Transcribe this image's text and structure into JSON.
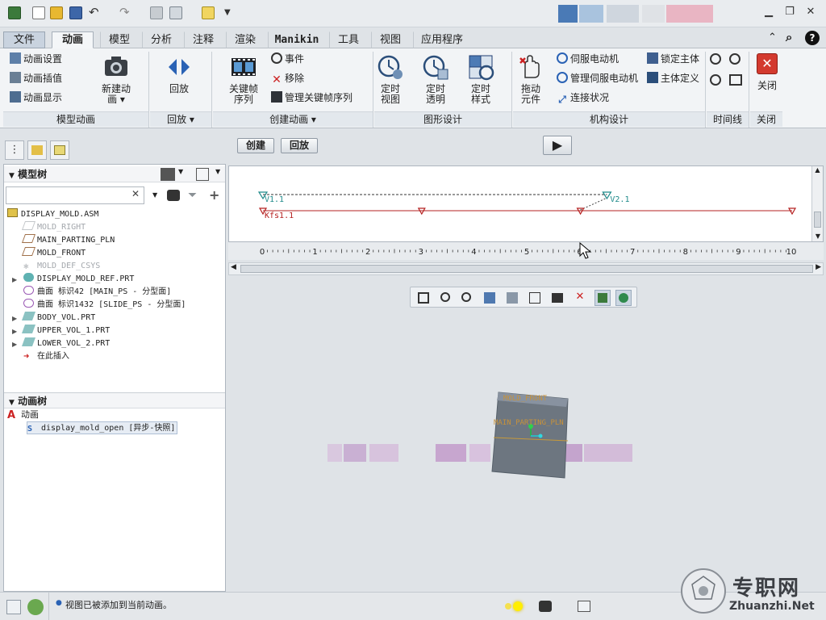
{
  "ribbon_tabs": [
    "文件",
    "动画",
    "模型",
    "分析",
    "注释",
    "渲染",
    "Manikin",
    "工具",
    "视图",
    "应用程序"
  ],
  "ribbon": {
    "model_anim": {
      "settings": "动画设置",
      "interp": "动画插值",
      "display": "动画显示",
      "new_line1": "新建动",
      "new_line2": "画",
      "group": "模型动画"
    },
    "playback": {
      "label": "回放",
      "group": "回放"
    },
    "create": {
      "keyframe_line1": "关键帧",
      "keyframe_line2": "序列",
      "event": "事件",
      "remove": "移除",
      "manage": "管理关键帧序列",
      "group": "创建动画"
    },
    "graphics": {
      "timed_view_line1": "定时",
      "timed_view_line2": "视图",
      "timed_trans_line1": "定时",
      "timed_trans_line2": "透明",
      "timed_style_line1": "定时",
      "timed_style_line2": "样式",
      "group": "图形设计"
    },
    "mech": {
      "drag_line1": "拖动",
      "drag_line2": "元件",
      "servo": "伺服电动机",
      "manage_servo": "管理伺服电动机",
      "conn": "连接状况",
      "lock": "锁定主体",
      "body_def": "主体定义",
      "group": "机构设计"
    },
    "timeline": {
      "group": "时间线"
    },
    "close": {
      "label": "关闭",
      "group": "关闭"
    }
  },
  "action_buttons": {
    "create": "创建",
    "playback": "回放"
  },
  "model_tree": {
    "title": "模型树",
    "items": [
      {
        "label": "DISPLAY_MOLD.ASM",
        "dim": false
      },
      {
        "label": "MOLD_RIGHT",
        "dim": true
      },
      {
        "label": "MAIN_PARTING_PLN",
        "dim": false
      },
      {
        "label": "MOLD_FRONT",
        "dim": false
      },
      {
        "label": "MOLD_DEF_CSYS",
        "dim": true
      },
      {
        "label": "DISPLAY_MOLD_REF.PRT",
        "dim": false
      },
      {
        "label": "曲面 标识42 [MAIN_PS - 分型面]",
        "dim": false
      },
      {
        "label": "曲面 标识1432 [SLIDE_PS - 分型面]",
        "dim": false
      },
      {
        "label": "BODY_VOL.PRT",
        "dim": false
      },
      {
        "label": "UPPER_VOL_1.PRT",
        "dim": false
      },
      {
        "label": "LOWER_VOL_2.PRT",
        "dim": false
      },
      {
        "label": "在此插入",
        "dim": false
      }
    ]
  },
  "anim_tree": {
    "title": "动画树",
    "root": "动画",
    "child": "display_mold_open [异步-快照]"
  },
  "timeline": {
    "start_label": "V1.1",
    "end_label": "V2.1",
    "kfs_label": "Kfs1.1",
    "ruler_ticks": [
      "0",
      "1",
      "2",
      "3",
      "4",
      "5",
      "6",
      "7",
      "8",
      "9",
      "10"
    ],
    "keyframes": [
      0,
      3,
      6,
      10
    ],
    "view_start": 0,
    "view_end": 6.5
  },
  "viewport": {
    "label_front": "MOLD_FRONT",
    "label_parting": "MAIN_PARTING_PLN"
  },
  "status": {
    "message": "视图已被添加到当前动画。"
  },
  "watermark": {
    "site_cn": "专职网",
    "site_en": "Zhuanzhi.Net"
  },
  "colors": {
    "accent": "#2a62b5",
    "keyframe_red": "#b52020",
    "view_teal": "#1f8a8a",
    "model_grey": "#6d7680"
  }
}
